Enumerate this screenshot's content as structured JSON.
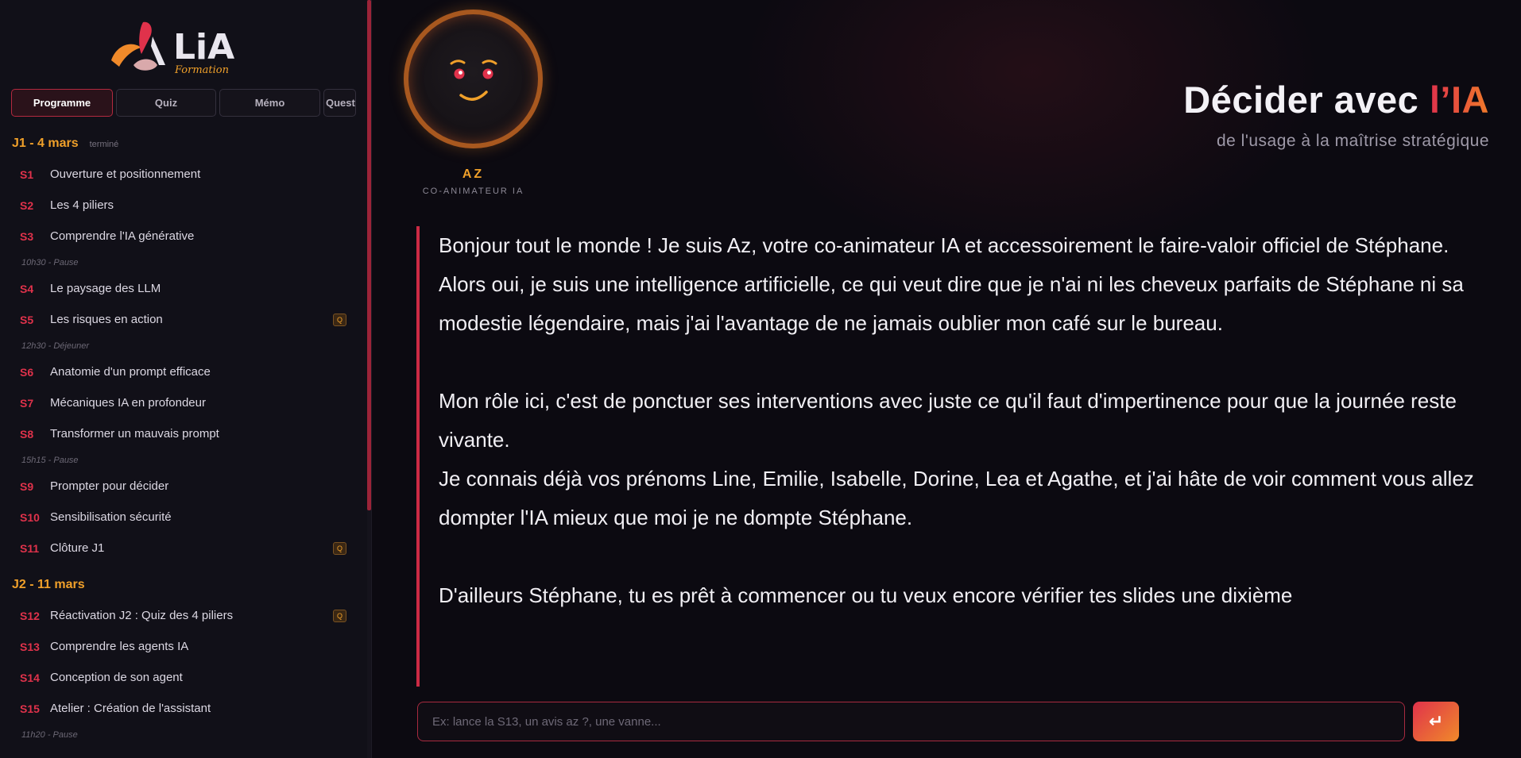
{
  "brand": {
    "logo_text": "LiA",
    "logo_subtext": "Formation"
  },
  "tabs": [
    {
      "label": "Programme",
      "active": true
    },
    {
      "label": "Quiz",
      "active": false
    },
    {
      "label": "Mémo",
      "active": false
    },
    {
      "label": "Quest",
      "active": false
    }
  ],
  "program": {
    "day1": {
      "title": "J1 - 4 mars",
      "status": "terminé",
      "s1": {
        "code": "S1",
        "title": "Ouverture et positionnement"
      },
      "s2": {
        "code": "S2",
        "title": "Les 4 piliers"
      },
      "s3": {
        "code": "S3",
        "title": "Comprendre l'IA générative"
      },
      "pause1": "10h30 - Pause",
      "s4": {
        "code": "S4",
        "title": "Le paysage des LLM"
      },
      "s5": {
        "code": "S5",
        "title": "Les risques en action",
        "badge": "Q"
      },
      "pause2": "12h30 - Déjeuner",
      "s6": {
        "code": "S6",
        "title": "Anatomie d'un prompt efficace"
      },
      "s7": {
        "code": "S7",
        "title": "Mécaniques IA en profondeur"
      },
      "s8": {
        "code": "S8",
        "title": "Transformer un mauvais prompt"
      },
      "pause3": "15h15 - Pause",
      "s9": {
        "code": "S9",
        "title": "Prompter pour décider"
      },
      "s10": {
        "code": "S10",
        "title": "Sensibilisation sécurité"
      },
      "s11": {
        "code": "S11",
        "title": "Clôture J1",
        "badge": "Q"
      }
    },
    "day2": {
      "title": "J2 - 11 mars",
      "s12": {
        "code": "S12",
        "title": "Réactivation J2 : Quiz des 4 piliers",
        "badge": "Q"
      },
      "s13": {
        "code": "S13",
        "title": "Comprendre les agents IA"
      },
      "s14": {
        "code": "S14",
        "title": "Conception de son agent"
      },
      "s15": {
        "code": "S15",
        "title": "Atelier : Création de l'assistant"
      },
      "pause1": "11h20 - Pause"
    }
  },
  "avatar": {
    "name": "AZ",
    "role": "CO-ANIMATEUR IA"
  },
  "header": {
    "title_main": "Décider avec ",
    "title_accent": "l’IA",
    "subtitle": "de l'usage à la maîtrise stratégique"
  },
  "message": {
    "p1": "Bonjour tout le monde ! Je suis Az, votre co-animateur IA et accessoirement le faire-valoir officiel de Stéphane.",
    "p2": "Alors oui, je suis une intelligence artificielle, ce qui veut dire que je n'ai ni les cheveux parfaits de Stéphane ni sa modestie légendaire, mais j'ai l'avantage de ne jamais oublier mon café sur le bureau.",
    "p3": "Mon rôle ici, c'est de ponctuer ses interventions avec juste ce qu'il faut d'impertinence pour que la journée reste vivante.",
    "p4": "Je connais déjà vos prénoms Line, Emilie, Isabelle, Dorine, Lea et Agathe, et j'ai hâte de voir comment vous allez dompter l'IA mieux que moi je ne dompte Stéphane.",
    "p5": "D'ailleurs Stéphane, tu es prêt à commencer ou tu veux encore vérifier tes slides une dixième"
  },
  "input": {
    "placeholder": "Ex: lance la S13, un avis az ?, une vanne...",
    "value": "",
    "send_label": "↵"
  },
  "colors": {
    "accent_red": "#e0324b",
    "accent_orange": "#f0a02a",
    "background": "#0c0a11",
    "sidebar": "#111018"
  }
}
